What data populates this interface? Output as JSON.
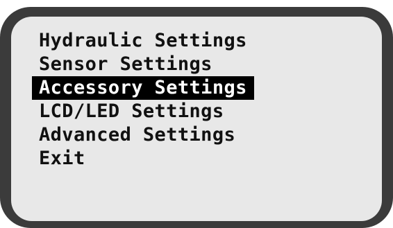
{
  "menu": {
    "items": [
      {
        "label": "Hydraulic Settings"
      },
      {
        "label": "Sensor Settings"
      },
      {
        "label": "Accessory Settings",
        "selected": true
      },
      {
        "label": "LCD/LED Settings"
      },
      {
        "label": "Advanced Settings"
      },
      {
        "label": "Exit"
      }
    ]
  },
  "colors": {
    "bezel": "#3b3b3b",
    "screen": "#e8e8e8",
    "text": "#111111",
    "highlight_bg": "#000000",
    "highlight_text": "#ffffff"
  }
}
